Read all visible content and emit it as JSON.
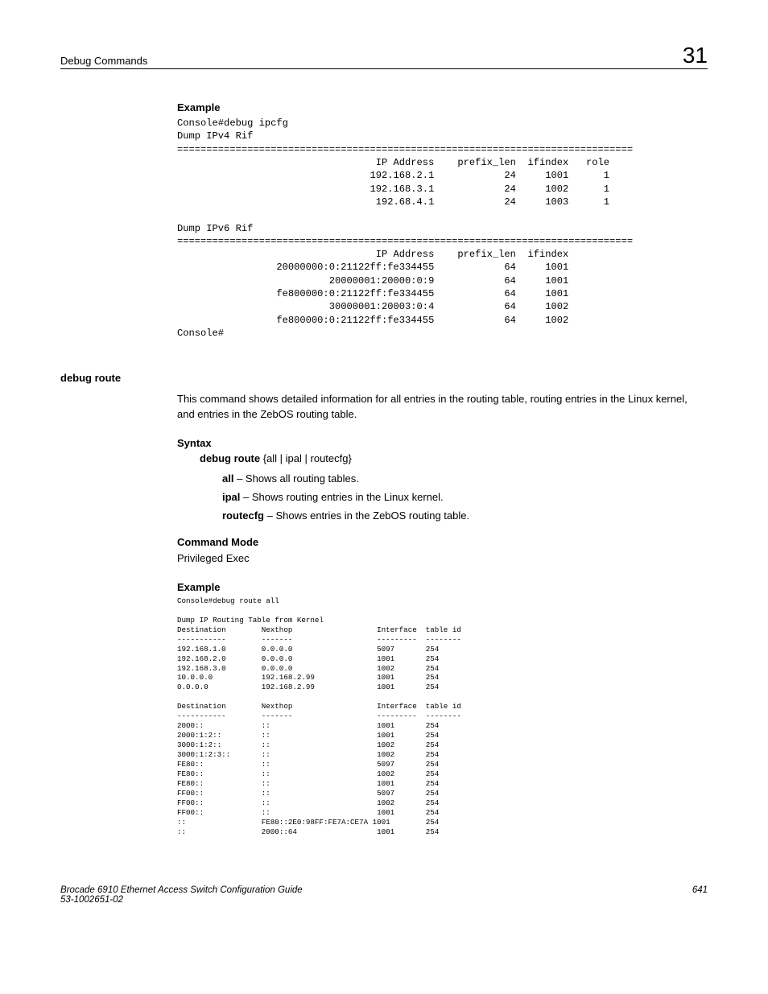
{
  "header": {
    "left": "Debug Commands",
    "right": "31"
  },
  "example1": {
    "heading": "Example",
    "block": "Console#debug ipcfg\nDump IPv4 Rif\n==============================================================================\n                                  IP Address    prefix_len  ifindex   role\n                                 192.168.2.1            24     1001      1\n                                 192.168.3.1            24     1002      1\n                                  192.68.4.1            24     1003      1\n\nDump IPv6 Rif\n==============================================================================\n                                  IP Address    prefix_len  ifindex\n                 20000000:0:21122ff:fe334455            64     1001\n                          20000001:20000:0:9            64     1001\n                 fe800000:0:21122ff:fe334455            64     1001\n                          30000001:20003:0:4            64     1002\n                 fe800000:0:21122ff:fe334455            64     1002\nConsole#"
  },
  "debug_route": {
    "label": "debug route",
    "description": "This command shows detailed information for all entries in the routing table, routing entries in the Linux kernel, and entries in the ZebOS routing table.",
    "syntax_heading": "Syntax",
    "syntax_cmd_prefix": "debug route ",
    "syntax_cmd_opts": "{all | ipal | routecfg}",
    "opt_all_b": "all",
    "opt_all_t": " – Shows all routing tables.",
    "opt_ipal_b": "ipal",
    "opt_ipal_t": " – Shows routing entries in the Linux kernel.",
    "opt_routecfg_b": "routecfg",
    "opt_routecfg_t": " – Shows entries in the ZebOS routing table.",
    "mode_heading": "Command Mode",
    "mode_text": "Privileged Exec",
    "example_heading": "Example",
    "example_block": "Console#debug route all\n\nDump IP Routing Table from Kernel\nDestination        Nexthop                   Interface  table id\n-----------        -------                   ---------  --------\n192.168.1.0        0.0.0.0                   5097       254\n192.168.2.0        0.0.0.0                   1001       254\n192.168.3.0        0.0.0.0                   1002       254\n10.0.0.0           192.168.2.99              1001       254\n0.0.0.0            192.168.2.99              1001       254\n\nDestination        Nexthop                   Interface  table id\n-----------        -------                   ---------  --------\n2000::             ::                        1001       254\n2000:1:2::         ::                        1001       254\n3000:1:2::         ::                        1002       254\n3000:1:2:3::       ::                        1002       254\nFE80::             ::                        5097       254\nFE80::             ::                        1002       254\nFE80::             ::                        1001       254\nFF00::             ::                        5097       254\nFF00::             ::                        1002       254\nFF00::             ::                        1001       254\n::                 FE80::2E0:98FF:FE7A:CE7A 1001        254\n::                 2000::64                  1001       254"
  },
  "footer": {
    "title": "Brocade 6910 Ethernet Access Switch Configuration Guide",
    "docnum": "53-1002651-02",
    "page": "641"
  }
}
